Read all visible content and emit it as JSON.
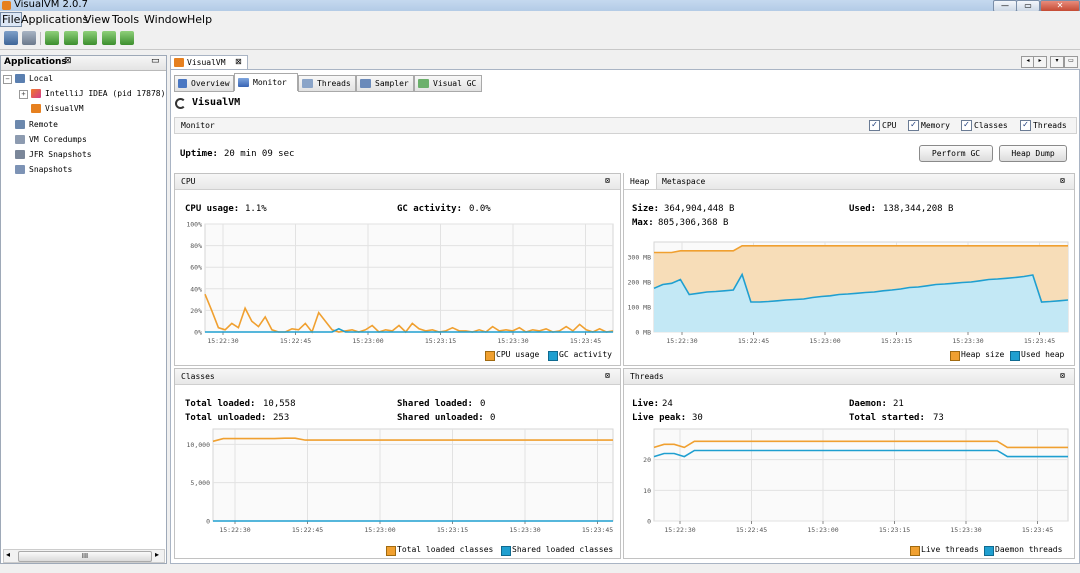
{
  "window": {
    "title": "VisualVM 2.0.7"
  },
  "menubar": [
    "File",
    "Applications",
    "View",
    "Tools",
    "Window",
    "Help"
  ],
  "left_panel": {
    "title": "Applications",
    "close": "⊠",
    "minimize": "▭",
    "tree": {
      "local": "Local",
      "intellij": "IntelliJ IDEA (pid 17878)",
      "visualvm": "VisualVM",
      "remote": "Remote",
      "vm_coredumps": "VM Coredumps",
      "jfr_snapshots": "JFR Snapshots",
      "snapshots": "Snapshots"
    },
    "hscroll_thumb": "III"
  },
  "document": {
    "tab_label": "VisualVM",
    "tab_close": "⊠",
    "subtabs": [
      "Overview",
      "Monitor",
      "Threads",
      "Sampler",
      "Visual GC"
    ],
    "app_title": "VisualVM",
    "monitor_label": "Monitor",
    "checkboxes": [
      "CPU",
      "Memory",
      "Classes",
      "Threads"
    ],
    "uptime_label": "Uptime:",
    "uptime_value": "20 min 09 sec",
    "perform_gc": "Perform GC",
    "heap_dump": "Heap Dump"
  },
  "cpu_panel": {
    "title": "CPU",
    "usage_label": "CPU usage:",
    "usage_value": "1.1%",
    "gc_label": "GC activity:",
    "gc_value": "0.0%",
    "legend": [
      "CPU usage",
      "GC activity"
    ]
  },
  "heap_panel": {
    "tabs": [
      "Heap",
      "Metaspace"
    ],
    "size_label": "Size:",
    "size_value": "364,904,448 B",
    "used_label": "Used:",
    "used_value": "138,344,208 B",
    "max_label": "Max:",
    "max_value": "805,306,368 B",
    "legend": [
      "Heap size",
      "Used heap"
    ]
  },
  "classes_panel": {
    "title": "Classes",
    "total_loaded_label": "Total loaded:",
    "total_loaded_value": "10,558",
    "total_unloaded_label": "Total unloaded:",
    "total_unloaded_value": "253",
    "shared_loaded_label": "Shared loaded:",
    "shared_loaded_value": "0",
    "shared_unloaded_label": "Shared unloaded:",
    "shared_unloaded_value": "0",
    "legend": [
      "Total loaded classes",
      "Shared loaded classes"
    ]
  },
  "threads_panel": {
    "title": "Threads",
    "live_label": "Live:",
    "live_value": "24",
    "live_peak_label": "Live peak:",
    "live_peak_value": "30",
    "daemon_label": "Daemon:",
    "daemon_value": "21",
    "total_started_label": "Total started:",
    "total_started_value": "73",
    "legend": [
      "Live threads",
      "Daemon threads"
    ]
  },
  "colors": {
    "orange": "#f0a030",
    "blue": "#1f9fd0",
    "fill_orange": "#f7ddb8",
    "fill_blue": "#c3e8f5"
  },
  "chart_data": [
    {
      "type": "line",
      "title": "CPU",
      "x_ticks": [
        "15:22:30",
        "15:22:45",
        "15:23:00",
        "15:23:15",
        "15:23:30",
        "15:23:45"
      ],
      "y_ticks": [
        "100%",
        "80%",
        "60%",
        "40%",
        "20%",
        "0%"
      ],
      "ylim": [
        0,
        100
      ],
      "series": [
        {
          "name": "CPU usage",
          "color": "#f0a030",
          "values": [
            35,
            20,
            4,
            2,
            8,
            4,
            22,
            10,
            5,
            14,
            2,
            0,
            0,
            3,
            2,
            8,
            0,
            18,
            10,
            2,
            0,
            1,
            2,
            0,
            2,
            6,
            0,
            2,
            1,
            6,
            0,
            8,
            3,
            1,
            2,
            0,
            1,
            4,
            1,
            1,
            0,
            2,
            0,
            5,
            1,
            2,
            1,
            4,
            0,
            2,
            1,
            3,
            0,
            1,
            5,
            1,
            7,
            2,
            0,
            3,
            0,
            1
          ]
        },
        {
          "name": "GC activity",
          "color": "#1f9fd0",
          "values": [
            0,
            0,
            0,
            0,
            0,
            0,
            0,
            0,
            0,
            0,
            0,
            0,
            0,
            0,
            0,
            0,
            0,
            0,
            0,
            0,
            3,
            0,
            0,
            0,
            0,
            0,
            0,
            0,
            0,
            0,
            0,
            0,
            0,
            0,
            0,
            0,
            0,
            0,
            0,
            0,
            0,
            0,
            0,
            0,
            0,
            0,
            0,
            0,
            0,
            0,
            0,
            0,
            0,
            0,
            0,
            0,
            0,
            0,
            0,
            0,
            0,
            0
          ]
        }
      ]
    },
    {
      "type": "area",
      "title": "Heap",
      "x_ticks": [
        "15:22:30",
        "15:22:45",
        "15:23:00",
        "15:23:15",
        "15:23:30",
        "15:23:45"
      ],
      "y_ticks": [
        "300 MB",
        "200 MB",
        "100 MB",
        "0 MB"
      ],
      "ylim": [
        0,
        360
      ],
      "series": [
        {
          "name": "Heap size",
          "color": "#f0a030",
          "values": [
            318,
            318,
            318,
            325,
            325,
            325,
            325,
            325,
            325,
            325,
            345,
            345,
            345,
            345,
            345,
            345,
            345,
            345,
            345,
            345,
            345,
            345,
            345,
            345,
            345,
            345,
            345,
            345,
            345,
            345,
            345,
            345,
            345,
            345,
            345,
            345,
            345,
            345,
            345,
            345,
            345,
            345,
            345,
            345,
            345,
            345,
            345,
            345
          ]
        },
        {
          "name": "Used heap",
          "color": "#1f9fd0",
          "values": [
            175,
            190,
            195,
            210,
            150,
            155,
            160,
            162,
            165,
            168,
            230,
            120,
            120,
            122,
            125,
            128,
            130,
            132,
            138,
            142,
            145,
            150,
            152,
            155,
            158,
            160,
            165,
            168,
            172,
            178,
            180,
            185,
            190,
            192,
            195,
            198,
            200,
            205,
            210,
            212,
            215,
            218,
            222,
            228,
            120,
            122,
            125,
            128
          ]
        }
      ]
    },
    {
      "type": "line",
      "title": "Classes",
      "x_ticks": [
        "15:22:30",
        "15:22:45",
        "15:23:00",
        "15:23:15",
        "15:23:30",
        "15:23:45"
      ],
      "y_ticks": [
        "10,000",
        "5,000",
        "0"
      ],
      "ylim": [
        0,
        12000
      ],
      "series": [
        {
          "name": "Total loaded classes",
          "color": "#f0a030",
          "values": [
            10400,
            10750,
            10750,
            10750,
            10750,
            10750,
            10750,
            10800,
            10800,
            10558,
            10558,
            10558,
            10558,
            10558,
            10558,
            10558,
            10558,
            10558,
            10558,
            10558,
            10558,
            10558,
            10558,
            10558,
            10558,
            10558,
            10558,
            10558,
            10558,
            10558,
            10558,
            10558,
            10558,
            10558,
            10558,
            10558,
            10558,
            10558,
            10558,
            10558
          ]
        },
        {
          "name": "Shared loaded classes",
          "color": "#1f9fd0",
          "values": [
            0,
            0,
            0,
            0,
            0,
            0,
            0,
            0,
            0,
            0,
            0,
            0,
            0,
            0,
            0,
            0,
            0,
            0,
            0,
            0,
            0,
            0,
            0,
            0,
            0,
            0,
            0,
            0,
            0,
            0,
            0,
            0,
            0,
            0,
            0,
            0,
            0,
            0,
            0,
            0
          ]
        }
      ]
    },
    {
      "type": "line",
      "title": "Threads",
      "x_ticks": [
        "15:22:30",
        "15:22:45",
        "15:23:00",
        "15:23:15",
        "15:23:30",
        "15:23:45"
      ],
      "y_ticks": [
        "20",
        "10",
        "0"
      ],
      "ylim": [
        0,
        30
      ],
      "series": [
        {
          "name": "Live threads",
          "color": "#f0a030",
          "values": [
            24,
            25,
            25,
            24,
            26,
            26,
            26,
            26,
            26,
            26,
            26,
            26,
            26,
            26,
            26,
            26,
            26,
            26,
            26,
            26,
            26,
            26,
            26,
            26,
            26,
            26,
            26,
            26,
            26,
            26,
            26,
            26,
            26,
            26,
            26,
            24,
            24,
            24,
            24,
            24,
            24,
            24
          ]
        },
        {
          "name": "Daemon threads",
          "color": "#1f9fd0",
          "values": [
            21,
            22,
            22,
            21,
            23,
            23,
            23,
            23,
            23,
            23,
            23,
            23,
            23,
            23,
            23,
            23,
            23,
            23,
            23,
            23,
            23,
            23,
            23,
            23,
            23,
            23,
            23,
            23,
            23,
            23,
            23,
            23,
            23,
            23,
            23,
            21,
            21,
            21,
            21,
            21,
            21,
            21
          ]
        }
      ]
    }
  ]
}
